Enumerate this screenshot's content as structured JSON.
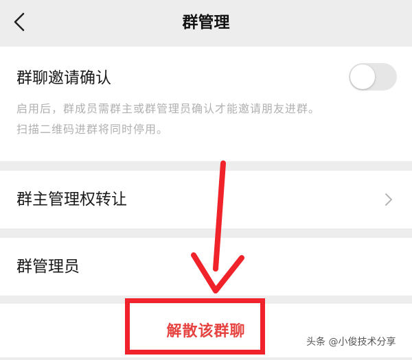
{
  "nav": {
    "title": "群管理",
    "back_icon": "chevron-left-icon"
  },
  "invite_confirm": {
    "label": "群聊邀请确认",
    "toggle_on": false,
    "description_line1": "启用后，群成员需群主或群管理员确认才能邀请朋友进群。",
    "description_line2": "扫描二维码进群将同时停用。"
  },
  "transfer": {
    "label": "群主管理权转让",
    "chevron_icon": "chevron-right-icon"
  },
  "admins": {
    "label": "群管理员"
  },
  "dissolve": {
    "label": "解散该群聊"
  },
  "annotation": {
    "arrow_color": "#f0222a",
    "box_color": "#f0222a"
  },
  "watermark": {
    "text": "头条 @小俊技术分享"
  },
  "colors": {
    "background": "#ededed",
    "card": "#ffffff",
    "danger": "#e64340",
    "hint": "#b0b0b0"
  }
}
